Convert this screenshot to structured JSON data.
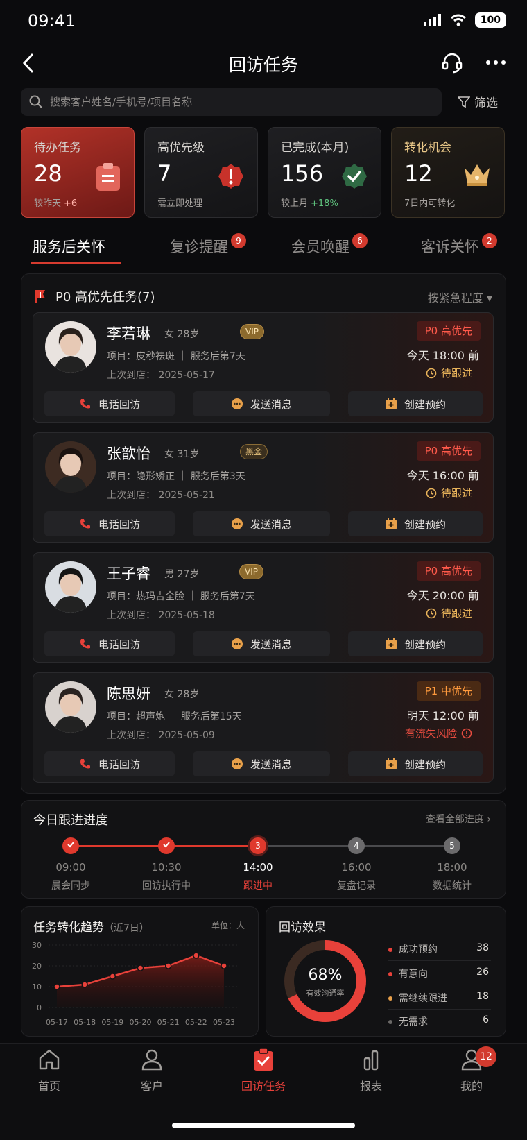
{
  "status_bar": {
    "time": "09:41",
    "battery": "100"
  },
  "header": {
    "title": "回访任务"
  },
  "search": {
    "placeholder": "搜索客户姓名/手机号/项目名称",
    "filter_label": "筛选"
  },
  "stats": [
    {
      "label": "待办任务",
      "value": "28",
      "sub": "较昨天",
      "delta": "+6"
    },
    {
      "label": "高优先级",
      "value": "7",
      "sub": "需立即处理"
    },
    {
      "label": "已完成(本月)",
      "value": "156",
      "sub": "较上月",
      "delta": "+18%"
    },
    {
      "label": "转化机会",
      "value": "12",
      "sub": "7日内可转化"
    }
  ],
  "tabs": [
    {
      "label": "服务后关怀"
    },
    {
      "label": "复诊提醒",
      "badge": "9"
    },
    {
      "label": "会员唤醒",
      "badge": "6"
    },
    {
      "label": "客诉关怀",
      "badge": "2"
    }
  ],
  "task_panel": {
    "title": "P0 高优先任务(7)",
    "sort_label": "按紧急程度"
  },
  "tasks": [
    {
      "name": "李若琳",
      "gender_age": "女 28岁",
      "tag": "VIP",
      "project": "项目：皮秒祛斑 ｜ 服务后第7天",
      "last_visit": "上次到店： 2025-05-17",
      "priority": "P0 高优先",
      "due": "今天 18:00 前",
      "state": "待跟进"
    },
    {
      "name": "张歆怡",
      "gender_age": "女 31岁",
      "tag": "黑金",
      "project": "项目：隐形矫正 ｜ 服务后第3天",
      "last_visit": "上次到店： 2025-05-21",
      "priority": "P0 高优先",
      "due": "今天 16:00 前",
      "state": "待跟进"
    },
    {
      "name": "王子睿",
      "gender_age": "男 27岁",
      "tag": "VIP",
      "project": "项目：热玛吉全脸 ｜ 服务后第7天",
      "last_visit": "上次到店： 2025-05-18",
      "priority": "P0 高优先",
      "due": "今天 20:00 前",
      "state": "待跟进"
    },
    {
      "name": "陈思妍",
      "gender_age": "女 28岁",
      "tag": "",
      "project": "项目：超声炮 ｜ 服务后第15天",
      "last_visit": "上次到店： 2025-05-09",
      "priority": "P1 中优先",
      "due": "明天 12:00 前",
      "state": "有流失风险"
    }
  ],
  "actions": {
    "call": "电话回访",
    "message": "发送消息",
    "appointment": "创建预约"
  },
  "progress": {
    "title": "今日跟进进度",
    "view_all": "查看全部进度",
    "steps": [
      {
        "time": "09:00",
        "label": "晨会同步",
        "status": "done"
      },
      {
        "time": "10:30",
        "label": "回访执行中",
        "status": "done"
      },
      {
        "time": "14:00",
        "label": "跟进中",
        "status": "current",
        "num": "3"
      },
      {
        "time": "16:00",
        "label": "复盘记录",
        "status": "todo",
        "num": "4"
      },
      {
        "time": "18:00",
        "label": "数据统计",
        "status": "todo",
        "num": "5"
      }
    ]
  },
  "trend": {
    "title": "任务转化趋势",
    "range": "（近7日）",
    "unit": "单位：人"
  },
  "chart_data": {
    "type": "area",
    "categories": [
      "05-17",
      "05-18",
      "05-19",
      "05-20",
      "05-21",
      "05-22",
      "05-23"
    ],
    "values": [
      10,
      11,
      15,
      19,
      20,
      25,
      20
    ],
    "ylim": [
      0,
      30
    ],
    "yticks": [
      "0",
      "10",
      "20",
      "30"
    ],
    "color": "#e8413a"
  },
  "effect": {
    "title": "回访效果",
    "percent": "68%",
    "percent_value": 68,
    "caption": "有效沟通率",
    "items": [
      {
        "label": "成功预约",
        "count": "38",
        "color": "#e8413a"
      },
      {
        "label": "有意向",
        "count": "26",
        "color": "#e8413a"
      },
      {
        "label": "需继续跟进",
        "count": "18",
        "color": "#e8a04a"
      },
      {
        "label": "无需求",
        "count": "6",
        "color": "#6b6967"
      }
    ]
  },
  "tabbar": [
    {
      "label": "首页"
    },
    {
      "label": "客户"
    },
    {
      "label": "回访任务"
    },
    {
      "label": "报表"
    },
    {
      "label": "我的",
      "badge": "12"
    }
  ]
}
